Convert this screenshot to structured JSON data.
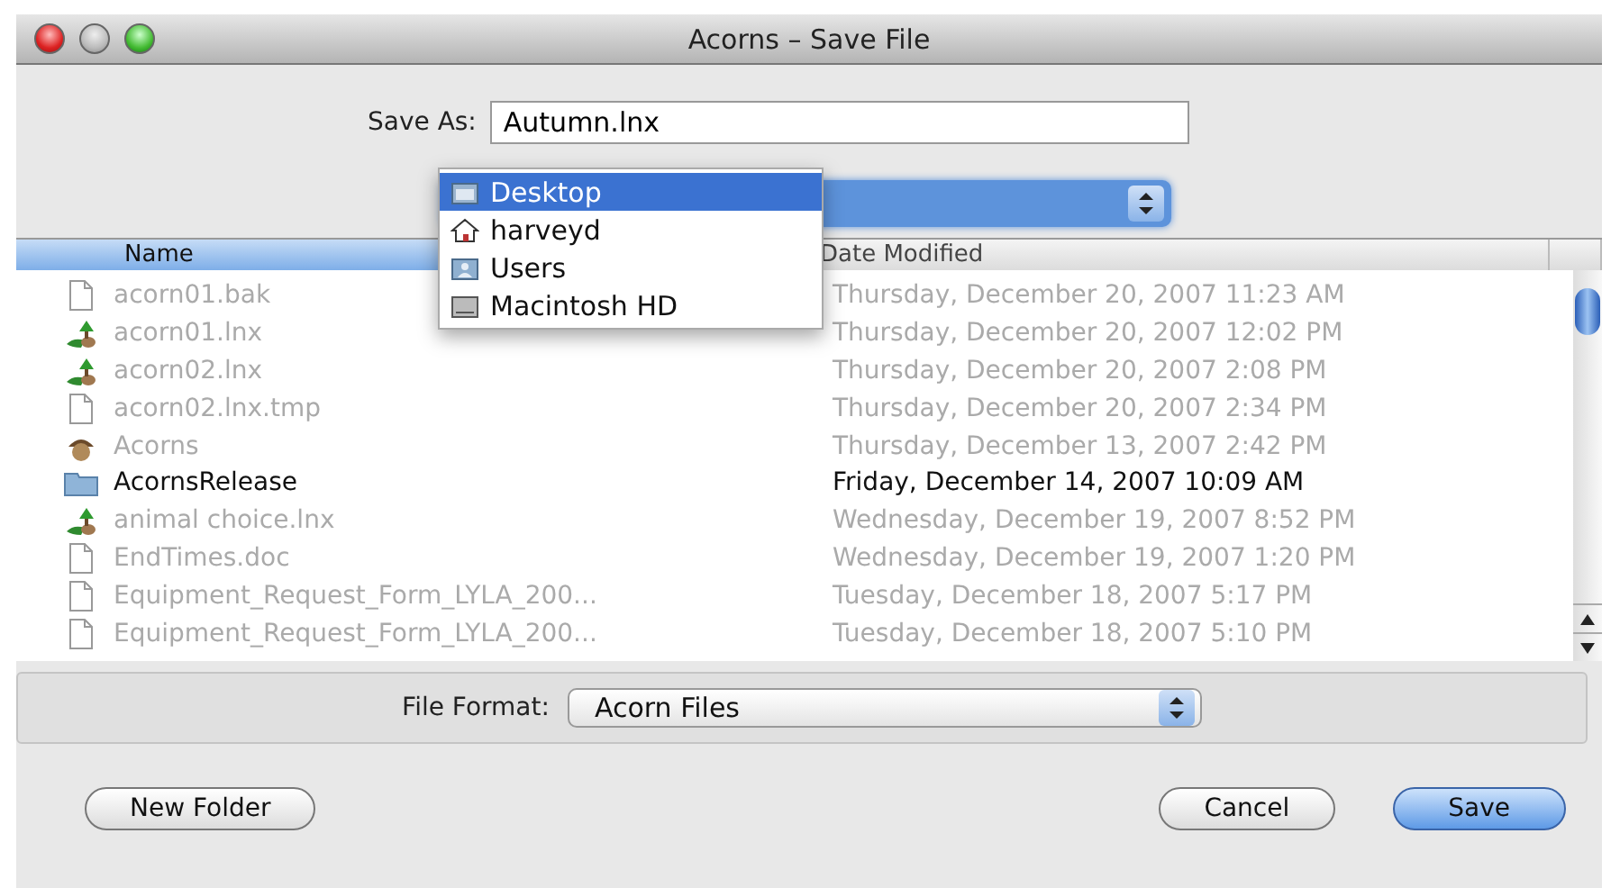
{
  "window": {
    "title": "Acorns – Save File"
  },
  "save_as": {
    "label": "Save As:",
    "value": "Autumn.lnx"
  },
  "location_menu": {
    "items": [
      {
        "label": "Desktop",
        "kind": "desktop",
        "selected": true
      },
      {
        "label": "harveyd",
        "kind": "home",
        "selected": false
      },
      {
        "label": "Users",
        "kind": "users",
        "selected": false
      },
      {
        "label": "Macintosh HD",
        "kind": "disk",
        "selected": false
      }
    ]
  },
  "table": {
    "columns": [
      {
        "label": "Name",
        "selected": true
      },
      {
        "label": "Date Modified",
        "selected": false
      }
    ],
    "rows": [
      {
        "name": "acorn01.bak",
        "date": "Thursday, December 20, 2007 11:23 AM",
        "kind": "document",
        "disabled": true
      },
      {
        "name": "acorn01.lnx",
        "date": "Thursday, December 20, 2007 12:02 PM",
        "kind": "lnx",
        "disabled": true
      },
      {
        "name": "acorn02.lnx",
        "date": "Thursday, December 20, 2007 2:08 PM",
        "kind": "lnx",
        "disabled": true
      },
      {
        "name": "acorn02.lnx.tmp",
        "date": "Thursday, December 20, 2007 2:34 PM",
        "kind": "document",
        "disabled": true
      },
      {
        "name": "Acorns",
        "date": "Thursday, December 13, 2007 2:42 PM",
        "kind": "app",
        "disabled": true
      },
      {
        "name": "AcornsRelease",
        "date": "Friday, December 14, 2007 10:09 AM",
        "kind": "folder",
        "disabled": false
      },
      {
        "name": "animal choice.lnx",
        "date": "Wednesday, December 19, 2007 8:52 PM",
        "kind": "lnx",
        "disabled": true
      },
      {
        "name": "EndTimes.doc",
        "date": "Wednesday, December 19, 2007 1:20 PM",
        "kind": "document",
        "disabled": true
      },
      {
        "name": "Equipment_Request_Form_LYLA_200...",
        "date": "Tuesday, December 18, 2007 5:17 PM",
        "kind": "document",
        "disabled": true
      },
      {
        "name": "Equipment_Request_Form_LYLA_200...",
        "date": "Tuesday, December 18, 2007 5:10 PM",
        "kind": "document",
        "disabled": true
      }
    ]
  },
  "file_format": {
    "label": "File Format:",
    "value": "Acorn Files"
  },
  "buttons": [
    {
      "label": "New Folder",
      "kind": "plain"
    },
    {
      "label": "Cancel",
      "kind": "plain"
    },
    {
      "label": "Save",
      "kind": "default"
    }
  ]
}
